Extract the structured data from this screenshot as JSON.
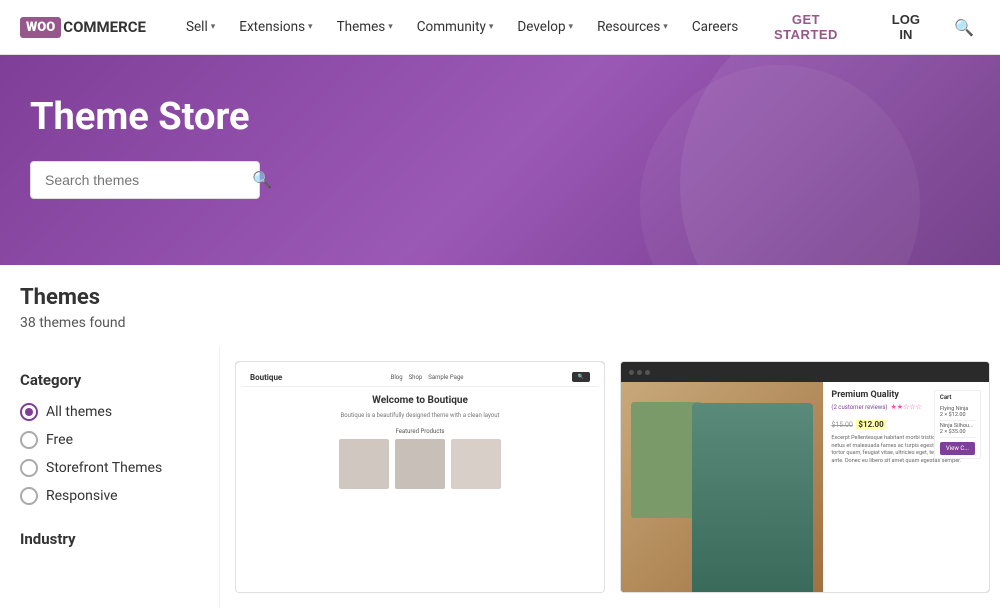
{
  "logo": {
    "woo": "WOO",
    "commerce": "COMMERCE"
  },
  "nav": {
    "items": [
      {
        "id": "sell",
        "label": "Sell",
        "hasDropdown": true
      },
      {
        "id": "extensions",
        "label": "Extensions",
        "hasDropdown": true
      },
      {
        "id": "themes",
        "label": "Themes",
        "hasDropdown": true
      },
      {
        "id": "community",
        "label": "Community",
        "hasDropdown": true
      },
      {
        "id": "develop",
        "label": "Develop",
        "hasDropdown": true
      },
      {
        "id": "resources",
        "label": "Resources",
        "hasDropdown": true
      },
      {
        "id": "careers",
        "label": "Careers",
        "hasDropdown": false
      }
    ],
    "get_started": "GET STARTED",
    "login": "LOG IN"
  },
  "hero": {
    "title": "Theme Store",
    "search_placeholder": "Search themes"
  },
  "sidebar": {
    "themes_heading": "Themes",
    "themes_count": "38 themes found",
    "category_title": "Category",
    "category_options": [
      {
        "id": "all",
        "label": "All themes",
        "selected": true
      },
      {
        "id": "free",
        "label": "Free",
        "selected": false
      },
      {
        "id": "storefront",
        "label": "Storefront Themes",
        "selected": false
      },
      {
        "id": "responsive",
        "label": "Responsive",
        "selected": false
      }
    ],
    "industry_title": "Industry"
  },
  "themes": {
    "card1": {
      "title": "Boutique",
      "welcome_text": "Welcome to Boutique",
      "desc": "Boutique is a beautifully designed theme with a clean layout",
      "featured_label": "Featured Products"
    },
    "card2": {
      "title": "Premium Quality",
      "reviews": "(2 customer reviews)",
      "price_old": "$15.00",
      "price_new": "$12.00",
      "desc_text": "Excerpt Pellentesque habitant morbi tristique senectus et netus et malesuada fames ac turpis egestas. Vestibulum tortor quam, feugiat vitae, ultricies eget, tempor sit amet, ante. Donec eu libero sit amet quam egestas semper.",
      "cart_label": "Cart",
      "cart_item1": "Flying Ninja",
      "cart_item1_price": "2 × $12.00",
      "cart_item2": "Ninja Silhou...",
      "cart_item2_price": "2 × $35.00",
      "view_cart": "View C..."
    }
  }
}
